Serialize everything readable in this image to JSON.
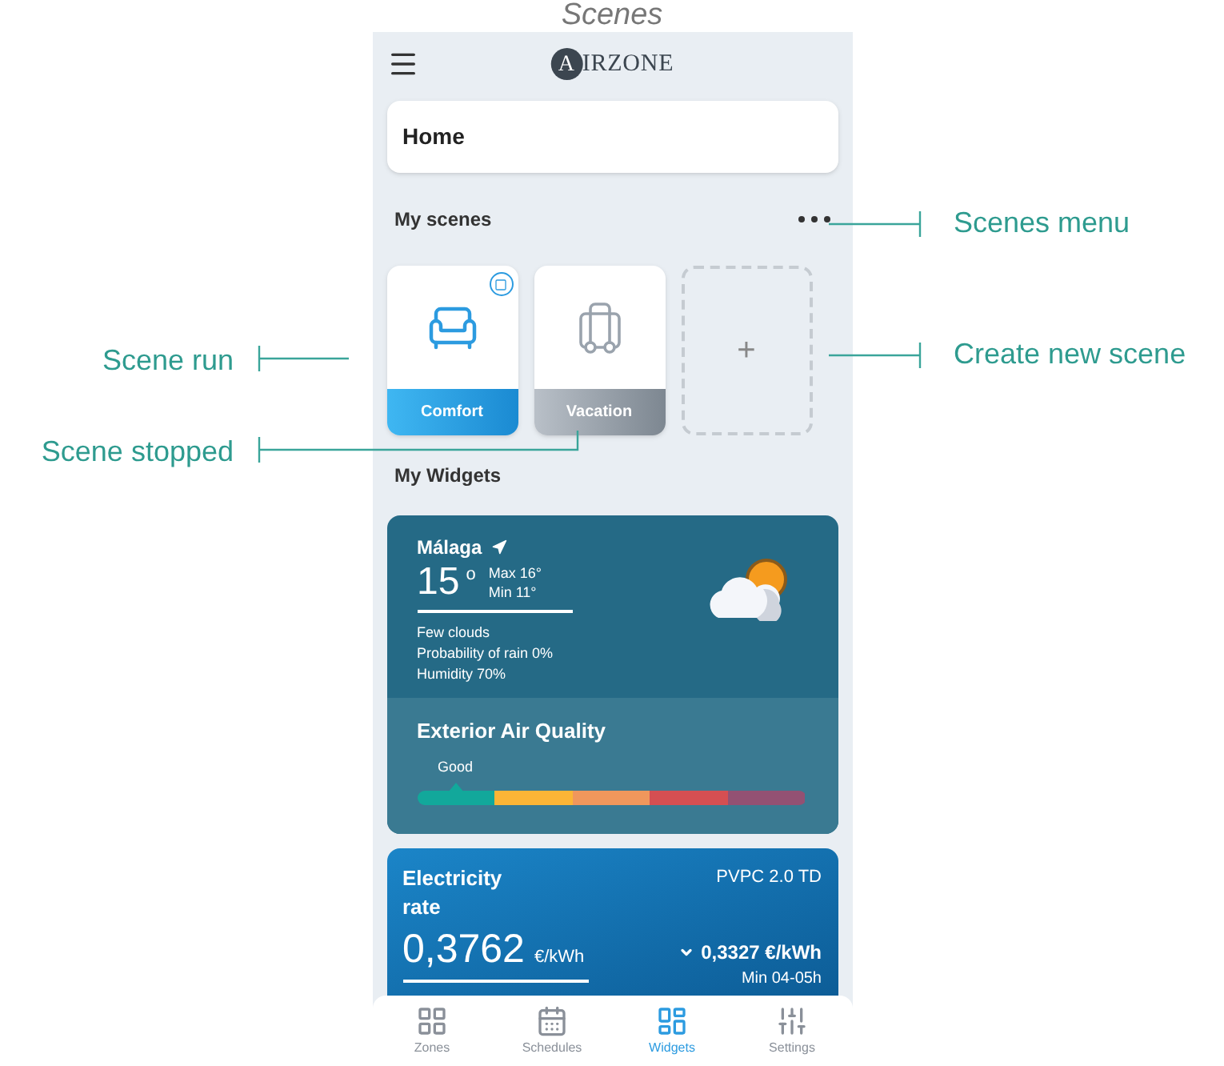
{
  "figure_title": "Scenes",
  "app": {
    "logo_letter": "A",
    "logo_rest": "IRZONE",
    "home": "Home",
    "scenes_header": "My scenes",
    "scenes": [
      {
        "kind": "armchair",
        "name": "Comfort",
        "running": true
      },
      {
        "kind": "suitcase",
        "name": "Vacation",
        "running": false
      }
    ],
    "add_scene": "+",
    "widgets_header": "My Widgets",
    "weather": {
      "city": "Málaga",
      "temperature": "15",
      "degree": "o",
      "max": "Max 16°",
      "min": "Min 11°",
      "lines": [
        "Few clouds",
        "Probability of rain 0%",
        "Humidity 70%"
      ]
    },
    "air_quality": {
      "title": "Exterior Air Quality",
      "reading": "Good",
      "level": 0.1
    },
    "electricity": {
      "title": "Electricity rate",
      "tariff": "PVPC 2.0 TD",
      "price": "0,3762",
      "unit": "€/kWh",
      "min_price": "0,3327 €/kWh",
      "min_time": "Min 04-05h"
    },
    "nav": [
      {
        "kind": "grid",
        "label": "Zones",
        "selected": false
      },
      {
        "kind": "calendar",
        "label": "Schedules",
        "selected": false
      },
      {
        "kind": "widgets",
        "label": "Widgets",
        "selected": true
      },
      {
        "kind": "sliders",
        "label": "Settings",
        "selected": false
      }
    ]
  },
  "callouts_right": [
    "Scenes menu",
    "Create new scene"
  ],
  "callouts_left": [
    "Scene run",
    "Scene stopped"
  ]
}
